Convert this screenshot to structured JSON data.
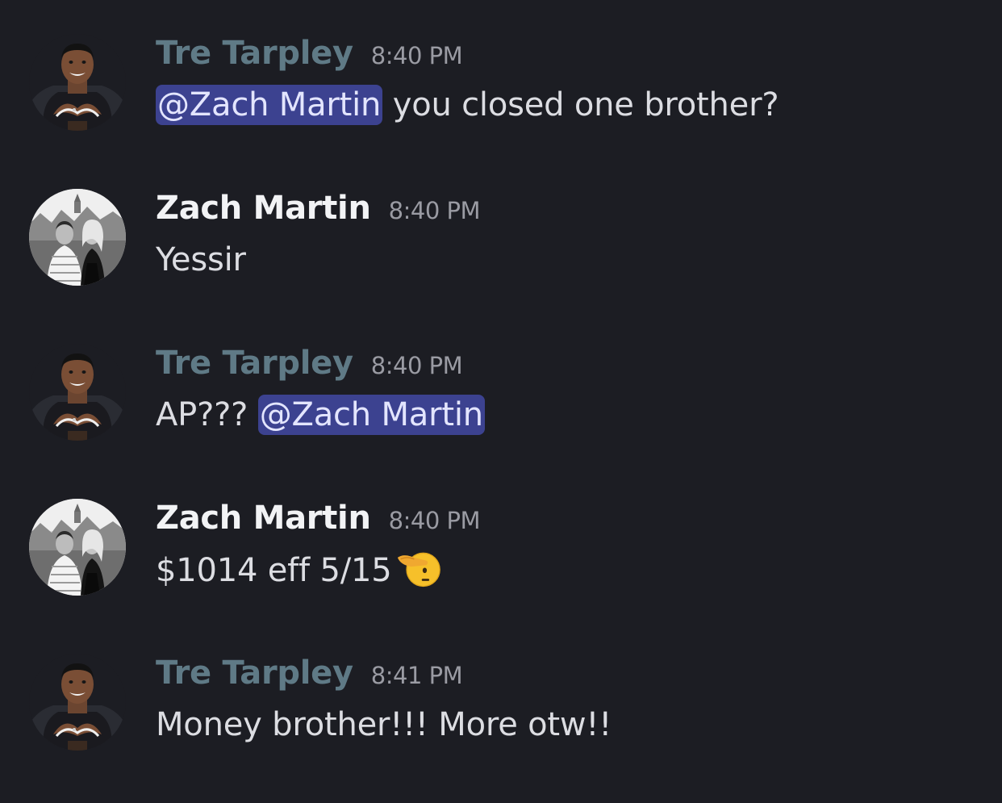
{
  "colors": {
    "background": "#1c1d23",
    "tre_name": "#5f7a86",
    "zach_name": "#f2f3f5",
    "timestamp": "#9a9ba3",
    "message_text": "#dcdde2",
    "mention_bg": "#3c4290",
    "mention_text": "#e3e5ff"
  },
  "messages": [
    {
      "author": "Tre Tarpley",
      "timestamp": "8:40 PM",
      "avatar": "tre-tarpley-avatar",
      "mention": "@Zach Martin",
      "text": " you closed one brother?"
    },
    {
      "author": "Zach Martin",
      "timestamp": "8:40 PM",
      "avatar": "zach-martin-avatar",
      "text": "Yessir"
    },
    {
      "author": "Tre Tarpley",
      "timestamp": "8:40 PM",
      "avatar": "tre-tarpley-avatar",
      "text": "AP??? ",
      "mention": "@Zach Martin"
    },
    {
      "author": "Zach Martin",
      "timestamp": "8:40 PM",
      "avatar": "zach-martin-avatar",
      "text": "$1014 eff 5/15",
      "emoji": "saluting-face-emoji"
    },
    {
      "author": "Tre Tarpley",
      "timestamp": "8:41 PM",
      "avatar": "tre-tarpley-avatar",
      "text": "Money brother!!! More otw!!"
    }
  ]
}
